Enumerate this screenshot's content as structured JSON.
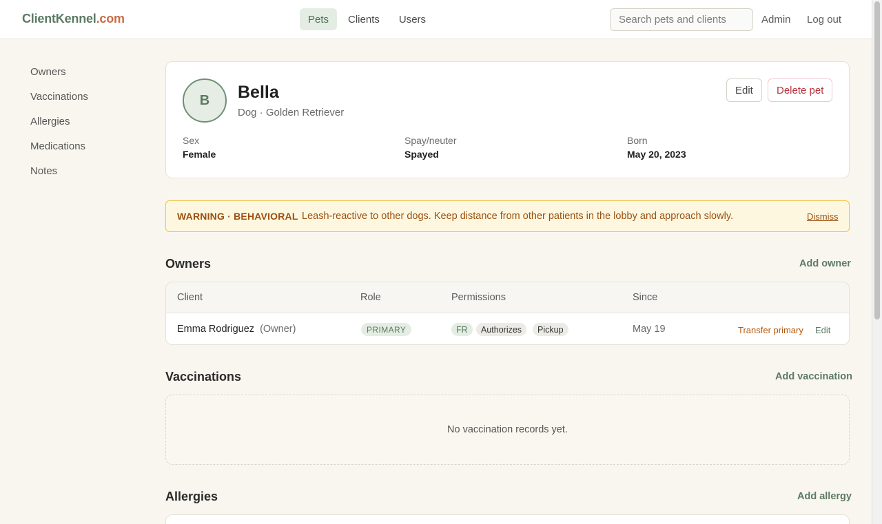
{
  "header": {
    "brand_name": "ClientKennel",
    "brand_tld": ".com",
    "nav": [
      {
        "label": "Pets",
        "active": true
      },
      {
        "label": "Clients",
        "active": false
      },
      {
        "label": "Users",
        "active": false
      }
    ],
    "search_placeholder": "Search pets and clients",
    "admin_label": "Admin",
    "logout_label": "Log out"
  },
  "sidebar": {
    "items": [
      {
        "label": "Owners"
      },
      {
        "label": "Vaccinations"
      },
      {
        "label": "Allergies"
      },
      {
        "label": "Medications"
      },
      {
        "label": "Notes"
      }
    ]
  },
  "pet": {
    "initial": "B",
    "name": "Bella",
    "subtitle": "Dog · Golden Retriever",
    "edit_label": "Edit",
    "delete_label": "Delete pet",
    "facts": [
      {
        "label": "Sex",
        "value": "Female"
      },
      {
        "label": "Spay/neuter",
        "value": "Spayed"
      },
      {
        "label": "Born",
        "value": "May 20, 2023"
      }
    ]
  },
  "warning": {
    "tag": "WARNING · BEHAVIORAL",
    "text": "Leash-reactive to other dogs. Keep distance from other patients in the lobby and approach slowly.",
    "dismiss_label": "Dismiss"
  },
  "owners": {
    "title": "Owners",
    "add_label": "Add owner",
    "columns": [
      "Client",
      "Role",
      "Permissions",
      "Since"
    ],
    "rows": [
      {
        "client_name": "Emma Rodriguez",
        "client_role": "(Owner)",
        "role_badge": "PRIMARY",
        "permissions": [
          "FR",
          "Authorizes",
          "Pickup"
        ],
        "since": "May 19",
        "transfer_label": "Transfer primary",
        "edit_label": "Edit"
      }
    ]
  },
  "vaccinations": {
    "title": "Vaccinations",
    "add_label": "Add vaccination",
    "empty_text": "No vaccination records yet."
  },
  "allergies": {
    "title": "Allergies",
    "add_label": "Add allergy"
  },
  "colors": {
    "brand_green": "#5c7a63",
    "brand_orange": "#c96a45",
    "danger": "#b8323f",
    "warning_bg": "#fef7e0",
    "warning_border": "#eec24a",
    "page_bg": "#f9f6ef"
  }
}
